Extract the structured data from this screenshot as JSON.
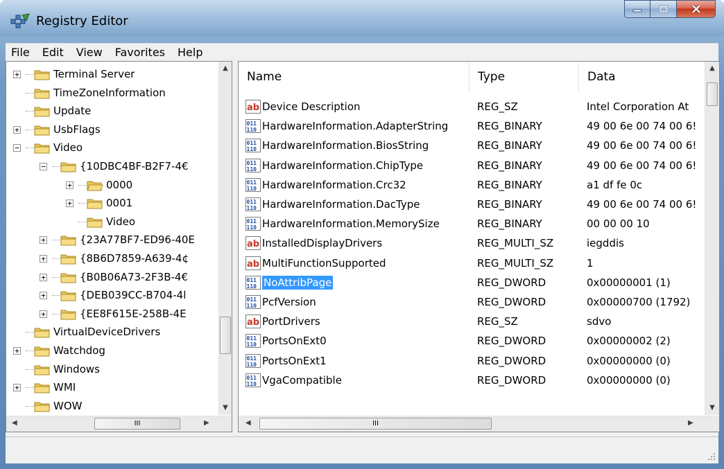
{
  "window": {
    "title": "Registry Editor",
    "controls": {
      "minimize": "minimize",
      "maximize": "maximize",
      "close": "close"
    }
  },
  "menu": [
    "File",
    "Edit",
    "View",
    "Favorites",
    "Help"
  ],
  "tree": {
    "items": [
      {
        "label": "Terminal Server",
        "expander": "+"
      },
      {
        "label": "TimeZoneInformation",
        "expander": ""
      },
      {
        "label": "Update",
        "expander": ""
      },
      {
        "label": "UsbFlags",
        "expander": "+"
      },
      {
        "label": "Video",
        "expander": "−"
      },
      {
        "label": "{10DBC4BF-B2F7-4€",
        "expander": "−"
      },
      {
        "label": "0000",
        "expander": "+"
      },
      {
        "label": "0001",
        "expander": "+"
      },
      {
        "label": "Video",
        "expander": ""
      },
      {
        "label": "{23A77BF7-ED96-40E",
        "expander": "+"
      },
      {
        "label": "{8B6D7859-A639-4¢",
        "expander": "+"
      },
      {
        "label": "{B0B06A73-2F3B-4€",
        "expander": "+"
      },
      {
        "label": "{DEB039CC-B704-4l",
        "expander": "+"
      },
      {
        "label": "{EE8F615E-258B-4E",
        "expander": "+"
      },
      {
        "label": "VirtualDeviceDrivers",
        "expander": ""
      },
      {
        "label": "Watchdog",
        "expander": "+"
      },
      {
        "label": "Windows",
        "expander": ""
      },
      {
        "label": "WMI",
        "expander": "+"
      },
      {
        "label": "WOW",
        "expander": ""
      }
    ],
    "scroll_thumb": "III"
  },
  "values": {
    "columns": {
      "name": "Name",
      "type": "Type",
      "data": "Data"
    },
    "rows": [
      {
        "icon": "string-value-icon",
        "name": "Device Description",
        "type": "REG_SZ",
        "data": "Intel Corporation At"
      },
      {
        "icon": "binary-value-icon",
        "name": "HardwareInformation.AdapterString",
        "type": "REG_BINARY",
        "data": "49 00 6e 00 74 00 6!"
      },
      {
        "icon": "binary-value-icon",
        "name": "HardwareInformation.BiosString",
        "type": "REG_BINARY",
        "data": "49 00 6e 00 74 00 6!"
      },
      {
        "icon": "binary-value-icon",
        "name": "HardwareInformation.ChipType",
        "type": "REG_BINARY",
        "data": "49 00 6e 00 74 00 6!"
      },
      {
        "icon": "binary-value-icon",
        "name": "HardwareInformation.Crc32",
        "type": "REG_BINARY",
        "data": "a1 df fe 0c"
      },
      {
        "icon": "binary-value-icon",
        "name": "HardwareInformation.DacType",
        "type": "REG_BINARY",
        "data": "49 00 6e 00 74 00 6!"
      },
      {
        "icon": "binary-value-icon",
        "name": "HardwareInformation.MemorySize",
        "type": "REG_BINARY",
        "data": "00 00 00 10"
      },
      {
        "icon": "string-value-icon",
        "name": "InstalledDisplayDrivers",
        "type": "REG_MULTI_SZ",
        "data": "iegddis"
      },
      {
        "icon": "string-value-icon",
        "name": "MultiFunctionSupported",
        "type": "REG_MULTI_SZ",
        "data": "1"
      },
      {
        "icon": "binary-value-icon",
        "name": "NoAttribPage",
        "type": "REG_DWORD",
        "data": "0x00000001 (1)",
        "selected": true
      },
      {
        "icon": "binary-value-icon",
        "name": "PcfVersion",
        "type": "REG_DWORD",
        "data": "0x00000700 (1792)"
      },
      {
        "icon": "string-value-icon",
        "name": "PortDrivers",
        "type": "REG_SZ",
        "data": "sdvo"
      },
      {
        "icon": "binary-value-icon",
        "name": "PortsOnExt0",
        "type": "REG_DWORD",
        "data": "0x00000002 (2)"
      },
      {
        "icon": "binary-value-icon",
        "name": "PortsOnExt1",
        "type": "REG_DWORD",
        "data": "0x00000000 (0)"
      },
      {
        "icon": "binary-value-icon",
        "name": "VgaCompatible",
        "type": "REG_DWORD",
        "data": "0x00000000 (0)"
      }
    ],
    "scroll_thumb": "III"
  },
  "colors": {
    "selection": "#3399ff",
    "folder": "#f3d36a",
    "string_icon": "#c0392b",
    "binary_icon": "#1f4fa5"
  }
}
